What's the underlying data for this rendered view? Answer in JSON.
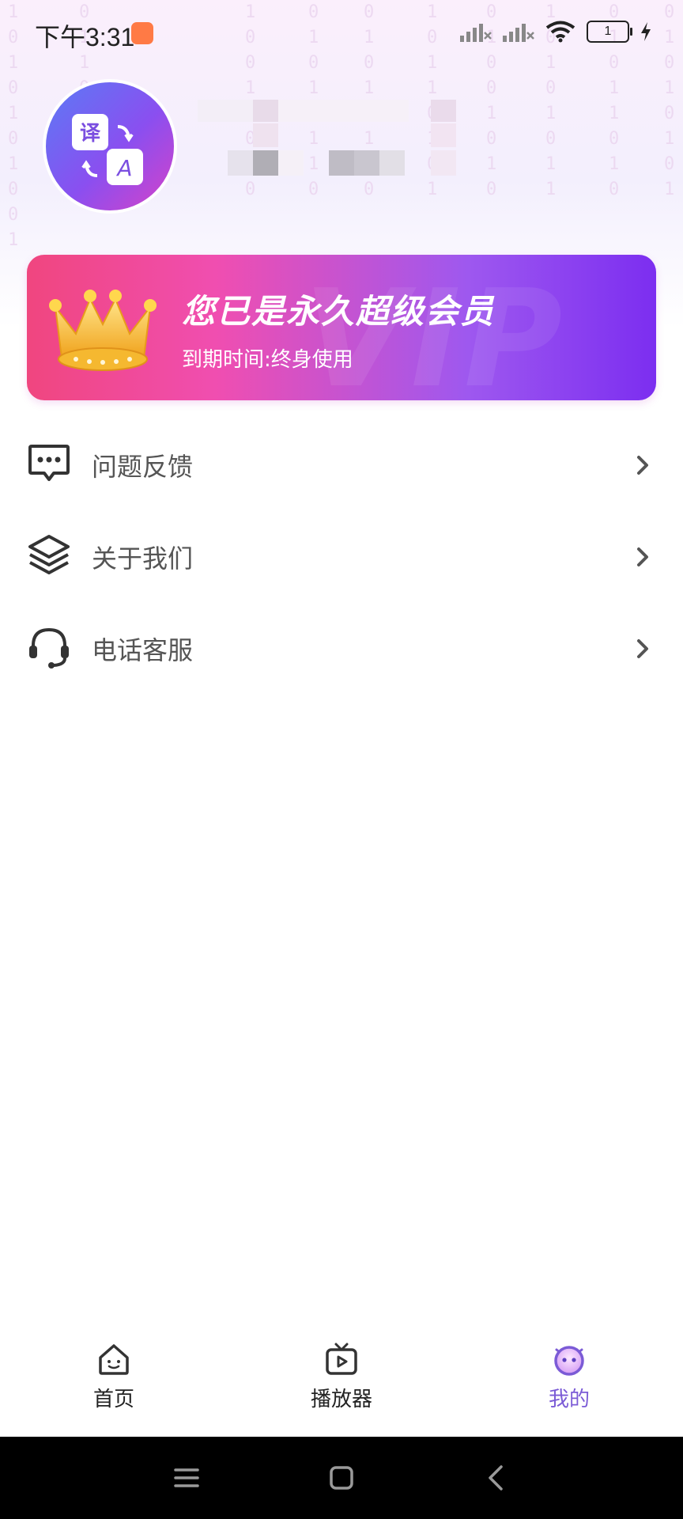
{
  "status_bar": {
    "time": "下午3:31",
    "battery_level": "1"
  },
  "profile": {
    "avatar_icon": "translate-icon",
    "avatar_text_top": "译",
    "avatar_text_bottom": "A"
  },
  "vip_card": {
    "title": "您已是永久超级会员",
    "subtitle": "到期时间:终身使用",
    "watermark": "VIP",
    "icon": "crown-icon"
  },
  "menu": {
    "items": [
      {
        "label": "问题反馈",
        "icon": "feedback-icon"
      },
      {
        "label": "关于我们",
        "icon": "layers-icon"
      },
      {
        "label": "电话客服",
        "icon": "headset-icon"
      }
    ]
  },
  "tabbar": {
    "tabs": [
      {
        "label": "首页",
        "icon": "home-icon",
        "active": false
      },
      {
        "label": "播放器",
        "icon": "tv-play-icon",
        "active": false
      },
      {
        "label": "我的",
        "icon": "mine-face-icon",
        "active": true
      }
    ],
    "active_color": "#7b5bd6"
  },
  "colors": {
    "vip_gradient_start": "#f0467f",
    "vip_gradient_end": "#7c2ef0",
    "avatar_gradient_start": "#5b7bf5",
    "avatar_gradient_end": "#d642c8"
  }
}
